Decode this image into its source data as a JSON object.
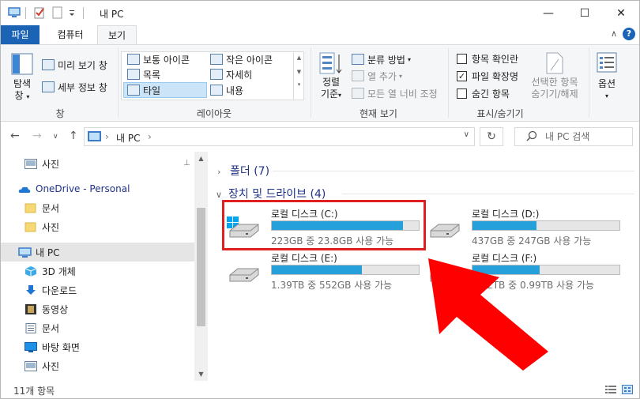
{
  "window": {
    "title": "내 PC",
    "minimize": "—",
    "maximize": "☐",
    "close": "✕"
  },
  "tabs": {
    "file": "파일",
    "computer": "컴퓨터",
    "view": "보기",
    "collapse": "∧",
    "help": "?"
  },
  "ribbon": {
    "pane": {
      "navigation_pane": "탐색\n창",
      "preview_pane": "미리 보기 창",
      "details_pane": "세부 정보 창",
      "group_label": "창"
    },
    "layout": {
      "items": [
        "보통 아이콘",
        "작은 아이콘",
        "목록",
        "자세히",
        "타일",
        "내용"
      ],
      "selected": "타일",
      "group_label": "레이아웃"
    },
    "current_view": {
      "sort_by": "정렬\n기준",
      "group_by": "분류 방법",
      "add_columns": "열 추가",
      "fit_columns": "모든 열 너비 조정",
      "group_label": "현재 보기"
    },
    "show_hide": {
      "item_checkboxes": "항목 확인란",
      "file_extensions": "파일 확장명",
      "hidden_items": "숨긴 항목",
      "item_checkboxes_checked": false,
      "file_extensions_checked": true,
      "hidden_items_checked": false,
      "hide_selected": "선택한 항목\n숨기기/해제",
      "group_label": "표시/숨기기"
    },
    "options": "옵션"
  },
  "navbar": {
    "back": "←",
    "forward": "→",
    "recent": "∨",
    "up": "↑",
    "breadcrumb_sep": "›",
    "breadcrumb": "내 PC",
    "breadcrumb_trail": "›",
    "dropdown": "∨",
    "refresh": "↻",
    "search_placeholder": "내 PC 검색"
  },
  "nav_pane": {
    "items": [
      {
        "label": "사진",
        "icon": "pictures-icon"
      },
      {
        "label": "OneDrive - Personal",
        "icon": "onedrive-icon"
      },
      {
        "label": "문서",
        "icon": "folder-icon"
      },
      {
        "label": "사진",
        "icon": "folder-icon"
      },
      {
        "label": "내 PC",
        "icon": "pc-icon"
      },
      {
        "label": "3D 개체",
        "icon": "3d-objects-icon"
      },
      {
        "label": "다운로드",
        "icon": "download-icon"
      },
      {
        "label": "동영상",
        "icon": "videos-icon"
      },
      {
        "label": "문서",
        "icon": "documents-icon"
      },
      {
        "label": "바탕 화면",
        "icon": "desktop-icon"
      },
      {
        "label": "사진",
        "icon": "pictures-icon"
      }
    ],
    "selected": "내 PC",
    "pin": "📌",
    "scroll_up": "▲",
    "scroll_down": "▼"
  },
  "content": {
    "folders_section": "폴더 (7)",
    "devices_section": "장치 및 드라이브 (4)",
    "collapsed_chevron": "›",
    "expanded_chevron": "∨",
    "drives": [
      {
        "name": "로컬 디스크 (C:)",
        "info": "223GB 중 23.8GB 사용 가능",
        "used_fraction": 0.893,
        "system": true
      },
      {
        "name": "로컬 디스크 (D:)",
        "info": "437GB 중 247GB 사용 가능",
        "used_fraction": 0.435,
        "system": false
      },
      {
        "name": "로컬 디스크 (E:)",
        "info": "1.39TB 중 552GB 사용 가능",
        "used_fraction": 0.612,
        "system": false
      },
      {
        "name": "로컬 디스크 (F:)",
        "info": "1.82TB 중 0.99TB 사용 가능",
        "used_fraction": 0.456,
        "system": false
      }
    ]
  },
  "status": {
    "item_count": "11개 항목"
  },
  "colors": {
    "accent": "#1a63b5",
    "drive_fill": "#26a0da",
    "highlight": "#e02020",
    "arrow": "#ff0000"
  }
}
